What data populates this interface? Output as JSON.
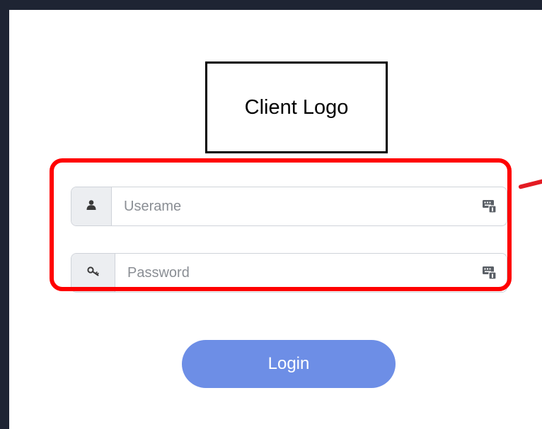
{
  "logo": {
    "label": "Client Logo"
  },
  "form": {
    "username": {
      "placeholder": "Userame",
      "value": "",
      "icon": "user-icon",
      "autofill_icon": "keyboard-autofill-icon"
    },
    "password": {
      "placeholder": "Password",
      "value": "",
      "icon": "key-icon",
      "autofill_icon": "keyboard-autofill-icon"
    }
  },
  "login_button": {
    "label": "Login"
  },
  "colors": {
    "background": "#1e2433",
    "panel": "#ffffff",
    "highlight": "#ff0000",
    "button": "#6d8ee6",
    "button_text": "#ffffff"
  }
}
